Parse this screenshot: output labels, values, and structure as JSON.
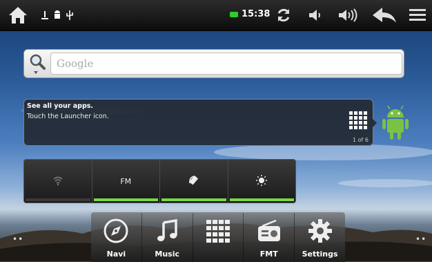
{
  "status_bar": {
    "home_icon": "home-icon",
    "notifications": [
      "usb-debug-icon",
      "android-icon",
      "usb-icon"
    ],
    "battery_color": "#2ecc2e",
    "time": "15:38",
    "actions": [
      "sync-icon",
      "volume-down-icon",
      "volume-up-icon",
      "back-icon",
      "menu-icon"
    ]
  },
  "search": {
    "placeholder": "Google"
  },
  "tip": {
    "title": "See all your apps.",
    "body": "Touch the Launcher icon.",
    "page": "1 of 6"
  },
  "power_widget": {
    "toggles": [
      {
        "name": "wifi",
        "label": "",
        "active": false
      },
      {
        "name": "fm",
        "label": "FM",
        "active": true
      },
      {
        "name": "rotate",
        "label": "",
        "active": true
      },
      {
        "name": "brightness",
        "label": "",
        "active": true
      }
    ],
    "accent": "#7ad84a"
  },
  "home_pages": {
    "left_dots": "••",
    "right_dots": "••"
  },
  "dock": {
    "items": [
      {
        "label": "Navi",
        "icon": "compass-icon"
      },
      {
        "label": "Music",
        "icon": "music-note-icon"
      },
      {
        "label": "",
        "icon": "app-grid-icon"
      },
      {
        "label": "FMT",
        "icon": "radio-icon"
      },
      {
        "label": "Settings",
        "icon": "gear-icon"
      }
    ]
  }
}
